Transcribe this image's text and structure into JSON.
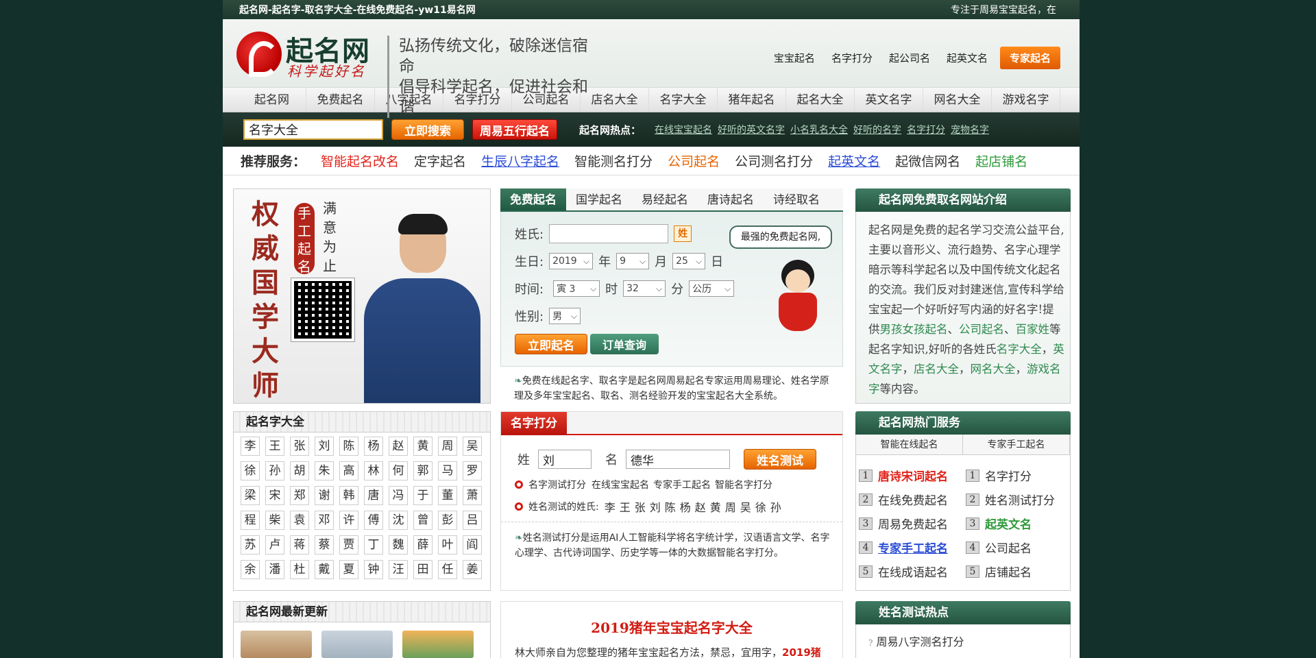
{
  "topbar": {
    "left": "起名网-起名字-取名字大全-在线免费起名-yw11易名网",
    "right": "专注于周易宝宝起名，在"
  },
  "logo": {
    "title": "起名网",
    "subtitle": "科学起好名"
  },
  "slogan": {
    "line1": "弘扬传统文化，破除迷信宿命",
    "line2": "倡导科学起名，促进社会和谐"
  },
  "topnav": [
    "宝宝起名",
    "名字打分",
    "起公司名",
    "起英文名"
  ],
  "expert_button": "专家起名",
  "mainnav": [
    "起名网",
    "免费起名",
    "八字起名",
    "名字打分",
    "公司起名",
    "店名大全",
    "名字大全",
    "猪年起名",
    "起名大全",
    "英文名字",
    "网名大全",
    "游戏名字"
  ],
  "search": {
    "value": "名字大全",
    "search_button": "立即搜索",
    "wuxing_button": "周易五行起名",
    "hot_label": "起名网热点："
  },
  "hot_links": [
    "在线宝宝起名",
    "好听的英文名字",
    "小名乳名大全",
    "好听的名字",
    "名字打分",
    "宠物名字"
  ],
  "rec": {
    "label": "推荐服务：",
    "items": [
      {
        "text": "智能起名改名",
        "color": "#e2231a",
        "underline": false
      },
      {
        "text": "定字起名",
        "color": "#333333",
        "underline": false
      },
      {
        "text": "生辰八字起名",
        "color": "#2a4bd6",
        "underline": true
      },
      {
        "text": "智能测名打分",
        "color": "#333333",
        "underline": false
      },
      {
        "text": "公司起名",
        "color": "#e66400",
        "underline": false
      },
      {
        "text": "公司测名打分",
        "color": "#333333",
        "underline": false
      },
      {
        "text": "起英文名",
        "color": "#2a4bd6",
        "underline": true
      },
      {
        "text": "起微信网名",
        "color": "#333333",
        "underline": false
      },
      {
        "text": "起店铺名",
        "color": "#2f9a3a",
        "underline": false
      }
    ]
  },
  "promo": {
    "big": [
      "权",
      "威",
      "国",
      "学",
      "大",
      "师"
    ],
    "seal": [
      "手",
      "工",
      "起",
      "名"
    ],
    "vtext": [
      "满",
      "意",
      "为",
      "止"
    ]
  },
  "names_box": {
    "title": "起名字大全",
    "chars": [
      "李",
      "王",
      "张",
      "刘",
      "陈",
      "杨",
      "赵",
      "黄",
      "周",
      "吴",
      "徐",
      "孙",
      "胡",
      "朱",
      "高",
      "林",
      "何",
      "郭",
      "马",
      "罗",
      "梁",
      "宋",
      "郑",
      "谢",
      "韩",
      "唐",
      "冯",
      "于",
      "董",
      "萧",
      "程",
      "柴",
      "袁",
      "邓",
      "许",
      "傅",
      "沈",
      "曾",
      "彭",
      "吕",
      "苏",
      "卢",
      "蒋",
      "蔡",
      "贾",
      "丁",
      "魏",
      "薛",
      "叶",
      "阎",
      "余",
      "潘",
      "杜",
      "戴",
      "夏",
      "钟",
      "汪",
      "田",
      "任",
      "姜"
    ]
  },
  "latest_box": {
    "title": "起名网最新更新"
  },
  "tabs": [
    "免费起名",
    "国学起名",
    "易经起名",
    "唐诗起名",
    "诗经取名"
  ],
  "form": {
    "surname_label": "姓氏:",
    "xing_icon": "姓",
    "birth_label": "生日:",
    "year": "2019",
    "year_unit": "年",
    "month": "9",
    "month_unit": "月",
    "day": "25",
    "day_unit": "日",
    "time_label": "时间:",
    "hour": "寅 3",
    "hour_unit": "时",
    "minute": "32",
    "minute_unit": "分",
    "calendar": "公历",
    "gender_label": "性别:",
    "gender": "男",
    "bubble": "最强的免费起名网,",
    "submit": "立即起名",
    "order": "订单查询",
    "desc": "免费在线起名字、取名字是起名网周易起名专家运用周易理论、姓名学原理及多年宝宝起名、取名、测名经验开发的宝宝起名大全系统。"
  },
  "score": {
    "title": "名字打分",
    "surname_label": "姓",
    "surname": "刘",
    "name_label": "名",
    "name": "德华",
    "button": "姓名测试",
    "links_label": "名字测试打分",
    "links": [
      "在线宝宝起名",
      "专家手工起名",
      "智能名字打分"
    ],
    "surnames_label": "姓名测试的姓氏:",
    "surnames": "李王张刘陈杨赵黄周吴徐孙",
    "desc": "姓名测试打分是运用AI人工智能科学将名字统计学，汉语语言文学、名字心理学、古代诗词国学、历史学等一体的大数据智能名字打分。"
  },
  "promo2": {
    "title": "2019猪年宝宝起名字大全",
    "text": "林大师亲自为您整理的猪年宝宝起名方法，禁忌，宜用字，",
    "highlight": "2019猪"
  },
  "intro": {
    "title": "起名网免费取名网站介绍",
    "text1": "起名网是免费的起名学习交流公益平台,主要以音形义、流行趋势、名字心理学暗示等科学起名以及中国传统文化起名的交流。我们反对封建迷信,宣传科学给宝宝起一个好听好写内涵的好名字!提供",
    "link1": "男孩女孩起名",
    "sep1": "、",
    "link2": "公司起名",
    "sep2": "、",
    "link3": "百家姓",
    "text2": "等起名字知识,好听的各姓氏",
    "link4": "名字大全",
    "sep3": "，",
    "link5": "英文名字",
    "sep4": "，",
    "link6": "店名大全",
    "sep5": "，",
    "link7": "网名大全",
    "sep6": "，",
    "link8": "游戏名字",
    "text3": "等内容。"
  },
  "hot_services": {
    "title": "起名网热门服务",
    "col1_head": "智能在线起名",
    "col2_head": "专家手工起名",
    "col1": [
      {
        "num": "1",
        "text": "唐诗宋词起名",
        "color": "#e2231a",
        "bold": true,
        "underline": false
      },
      {
        "num": "2",
        "text": "在线免费起名",
        "color": "#333333",
        "bold": false,
        "underline": false
      },
      {
        "num": "3",
        "text": "周易免费起名",
        "color": "#333333",
        "bold": false,
        "underline": false
      },
      {
        "num": "4",
        "text": "专家手工起名",
        "color": "#2a4bd6",
        "bold": true,
        "underline": true
      },
      {
        "num": "5",
        "text": "在线成语起名",
        "color": "#333333",
        "bold": false,
        "underline": false
      }
    ],
    "col2": [
      {
        "num": "1",
        "text": "名字打分",
        "color": "#333333",
        "bold": false,
        "underline": false
      },
      {
        "num": "2",
        "text": "姓名测试打分",
        "color": "#333333",
        "bold": false,
        "underline": false
      },
      {
        "num": "3",
        "text": "起英文名",
        "color": "#2f9a3a",
        "bold": true,
        "underline": false
      },
      {
        "num": "4",
        "text": "公司起名",
        "color": "#333333",
        "bold": false,
        "underline": false
      },
      {
        "num": "5",
        "text": "店铺起名",
        "color": "#333333",
        "bold": false,
        "underline": false
      }
    ]
  },
  "name_test_hot": {
    "title": "姓名测试热点",
    "item": "周易八字测名打分"
  },
  "colors": {
    "page_bg": "#14302a",
    "accent_green": "#2c6a52",
    "accent_red": "#d21c12",
    "accent_orange": "#e66400"
  }
}
